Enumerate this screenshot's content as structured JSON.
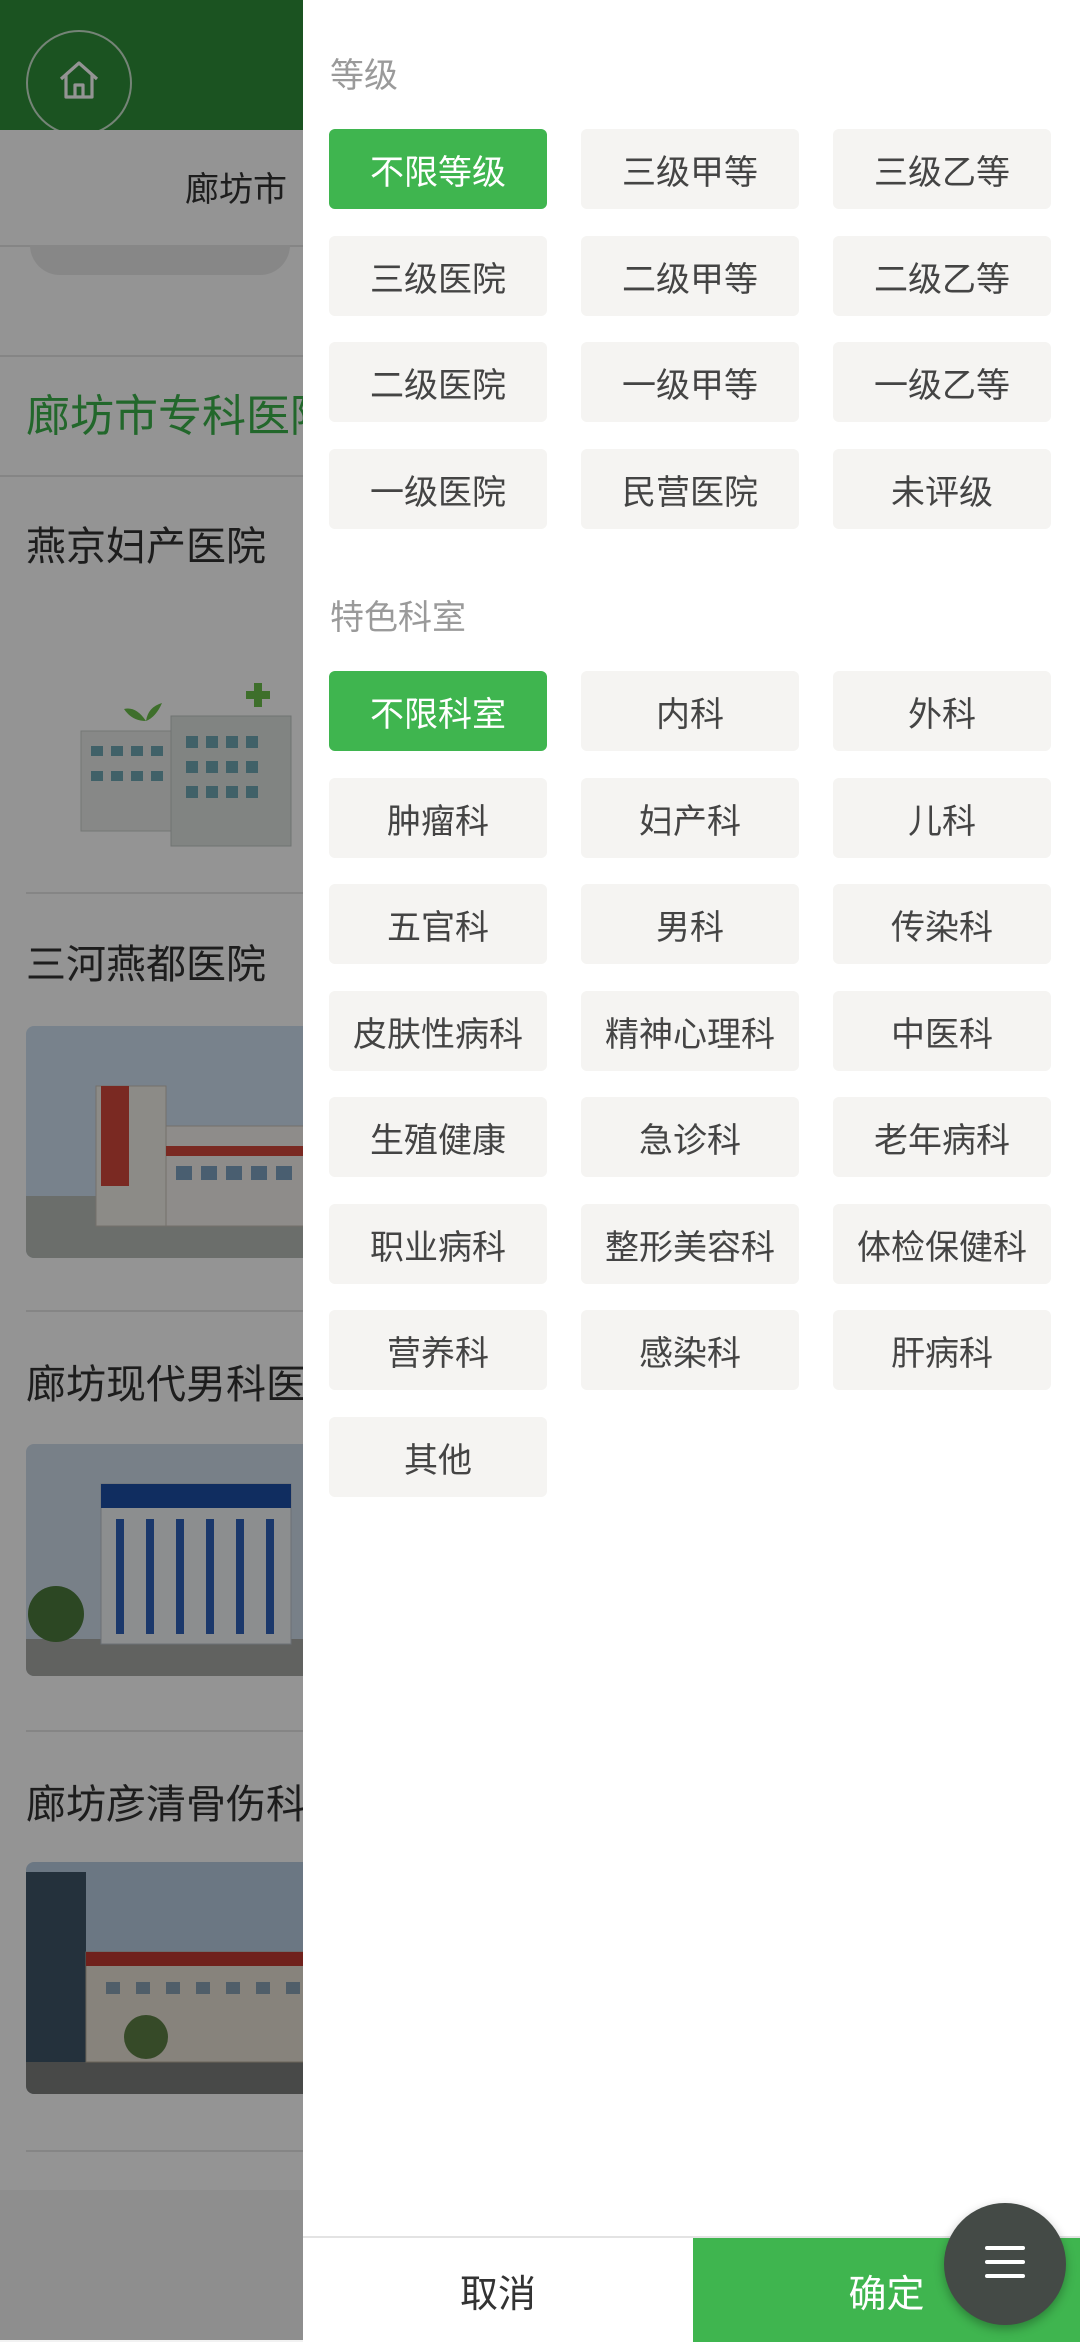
{
  "background": {
    "city_label": "廊坊市",
    "section_title": "廊坊市专科医院",
    "hospitals": [
      {
        "name": "燕京妇产医院"
      },
      {
        "name": "三河燕都医院"
      },
      {
        "name": "廊坊现代男科医院"
      },
      {
        "name": "廊坊彦清骨伤科中医医院"
      }
    ]
  },
  "drawer": {
    "level": {
      "title": "等级",
      "options": [
        "不限等级",
        "三级甲等",
        "三级乙等",
        "三级医院",
        "二级甲等",
        "二级乙等",
        "二级医院",
        "一级甲等",
        "一级乙等",
        "一级医院",
        "民营医院",
        "未评级"
      ],
      "selected": "不限等级"
    },
    "department": {
      "title": "特色科室",
      "options": [
        "不限科室",
        "内科",
        "外科",
        "肿瘤科",
        "妇产科",
        "儿科",
        "五官科",
        "男科",
        "传染科",
        "皮肤性病科",
        "精神心理科",
        "中医科",
        "生殖健康",
        "急诊科",
        "老年病科",
        "职业病科",
        "整形美容科",
        "体检保健科",
        "营养科",
        "感染科",
        "肝病科",
        "其他"
      ],
      "selected": "不限科室"
    },
    "footer": {
      "cancel": "取消",
      "confirm": "确定"
    }
  },
  "icons": {
    "home": "home-icon",
    "menu": "hamburger-menu-icon"
  },
  "colors": {
    "accent": "#3fb54f",
    "header": "#2f8f3a"
  }
}
